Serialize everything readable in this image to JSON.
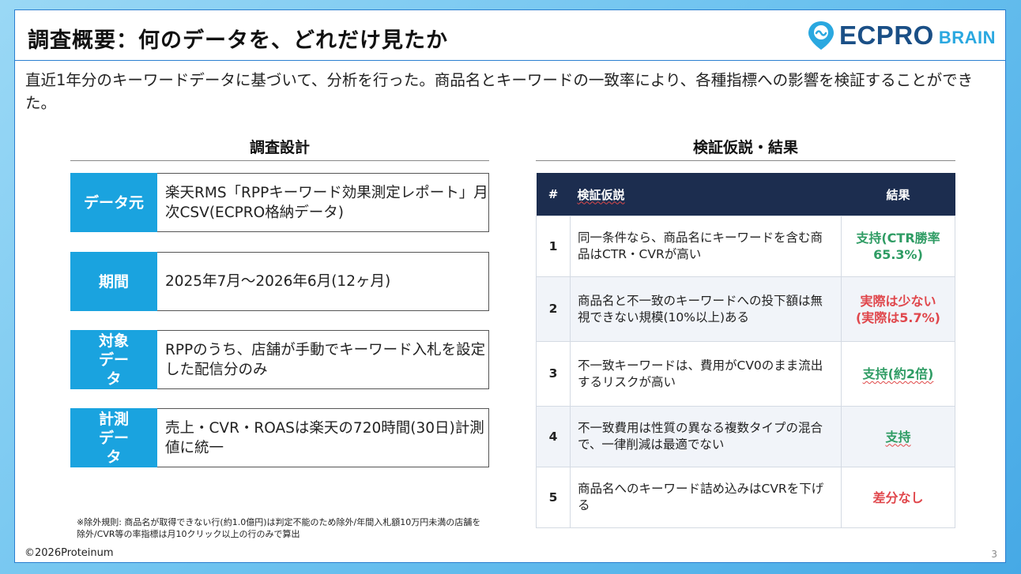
{
  "title": "調査概要：何のデータを、どれだけ見たか",
  "logo": {
    "main": "ECPRO",
    "sub": "BRAIN",
    "icon": "location-pin-icon",
    "colors": {
      "main": "#1a4f86",
      "sub": "#2aa8e0"
    }
  },
  "lead": "直近1年分のキーワードデータに基づいて、分析を行った。商品名とキーワードの一致率により、各種指標への影響を検証することができた。",
  "design": {
    "heading": "調査設計",
    "rows": [
      {
        "label": "データ元",
        "value": "楽天RMS「RPPキーワード効果測定レポート」月次CSV(ECPRO格納データ)"
      },
      {
        "label": "期間",
        "value": "2025年7月～2026年6月(12ヶ月)"
      },
      {
        "label": "対象データ",
        "value": "RPPのうち、店舗が手動でキーワード入札を設定した配信分のみ"
      },
      {
        "label": "計測データ",
        "value": "売上・CVR・ROASは楽天の720時間(30日)計測値に統一"
      }
    ]
  },
  "results": {
    "heading": "検証仮説・結果",
    "columns": {
      "num": "#",
      "hypothesis": "検証仮説",
      "result": "結果"
    },
    "rows": [
      {
        "num": "1",
        "hypothesis": "同一条件なら、商品名にキーワードを含む商品はCTR・CVRが高い",
        "result": "支持(CTR勝率65.3%)",
        "tone": "green"
      },
      {
        "num": "2",
        "hypothesis": "商品名と不一致のキーワードへの投下額は無視できない規模(10%以上)ある",
        "result": "実際は少ない(実際は5.7%)",
        "tone": "red"
      },
      {
        "num": "3",
        "hypothesis": "不一致キーワードは、費用がCV0のまま流出するリスクが高い",
        "result": "支持(約2倍)",
        "tone": "green"
      },
      {
        "num": "4",
        "hypothesis": "不一致費用は性質の異なる複数タイプの混合で、一律削減は最適でない",
        "result": "支持",
        "tone": "green"
      },
      {
        "num": "5",
        "hypothesis": "商品名へのキーワード詰め込みはCVRを下げる",
        "result": "差分なし",
        "tone": "red"
      }
    ],
    "colors": {
      "header": "#1c2d4f",
      "green": "#2f9c64",
      "red": "#e0474c"
    }
  },
  "note": "※除外規則: 商品名が取得できない行(約1.0億円)は判定不能のため除外/年間入札額10万円未満の店舗を除外/CVR等の率指標は月10クリック以上の行のみで算出",
  "footer": {
    "copyright": "©2026Proteinum",
    "page": "3"
  },
  "accent": "#1aa3df"
}
